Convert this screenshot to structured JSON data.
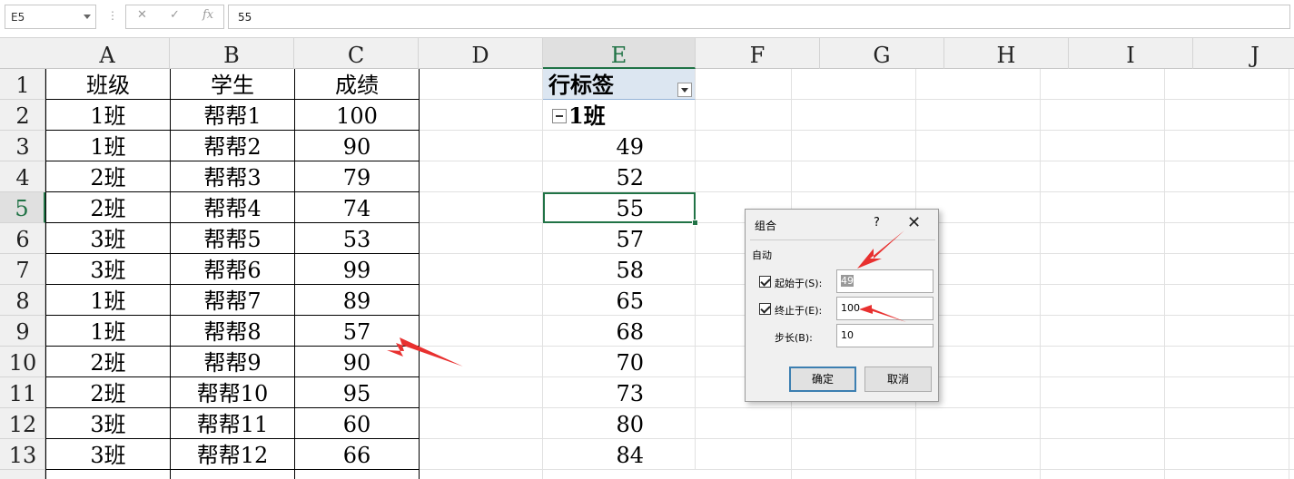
{
  "formula_bar": {
    "name_box": "E5",
    "cancel": "✕",
    "enter": "✓",
    "fx": "fx",
    "content": "55"
  },
  "columns": [
    "A",
    "B",
    "C",
    "D",
    "E",
    "F",
    "G",
    "H",
    "I",
    "J"
  ],
  "selected_column": "E",
  "rows": [
    "1",
    "2",
    "3",
    "4",
    "5",
    "6",
    "7",
    "8",
    "9",
    "10",
    "11",
    "12",
    "13"
  ],
  "selected_row": "5",
  "table": {
    "headers": [
      "班级",
      "学生",
      "成绩"
    ],
    "rows": [
      [
        "1班",
        "帮帮1",
        "100"
      ],
      [
        "1班",
        "帮帮2",
        "90"
      ],
      [
        "2班",
        "帮帮3",
        "79"
      ],
      [
        "2班",
        "帮帮4",
        "74"
      ],
      [
        "3班",
        "帮帮5",
        "53"
      ],
      [
        "3班",
        "帮帮6",
        "99"
      ],
      [
        "1班",
        "帮帮7",
        "89"
      ],
      [
        "1班",
        "帮帮8",
        "57"
      ],
      [
        "2班",
        "帮帮9",
        "90"
      ],
      [
        "2班",
        "帮帮10",
        "95"
      ],
      [
        "3班",
        "帮帮11",
        "60"
      ],
      [
        "3班",
        "帮帮12",
        "66"
      ]
    ]
  },
  "pivot": {
    "header": "行标签",
    "group": "1班",
    "values": [
      "49",
      "52",
      "55",
      "57",
      "58",
      "65",
      "68",
      "70",
      "73",
      "80",
      "84"
    ]
  },
  "dialog": {
    "title": "组合",
    "help": "?",
    "close": "✕",
    "group_label": "自动",
    "start_label": "起始于(S):",
    "start_value": "49",
    "start_checked": true,
    "end_label": "终止于(E):",
    "end_value": "100",
    "end_checked": true,
    "step_label": "步长(B):",
    "step_value": "10",
    "ok": "确定",
    "cancel": "取消"
  },
  "colors": {
    "accent": "#217346",
    "arrow": "#e8302f",
    "pivot_header_bg": "#dce6f1"
  }
}
